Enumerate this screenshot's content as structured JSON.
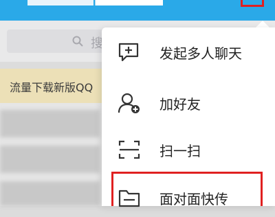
{
  "search": {
    "placeholder_text": "搜"
  },
  "notice": {
    "text": "流量下载新版QQ"
  },
  "menu": {
    "items": [
      {
        "label": "发起多人聊天",
        "icon": "chat-plus-icon"
      },
      {
        "label": "加好友",
        "icon": "add-friend-icon"
      },
      {
        "label": "扫一扫",
        "icon": "scan-icon"
      },
      {
        "label": "面对面快传",
        "icon": "folder-transfer-icon"
      }
    ]
  },
  "colors": {
    "header": "#2aa9e8",
    "highlight": "#e02020",
    "notice": "#ece0b7"
  }
}
